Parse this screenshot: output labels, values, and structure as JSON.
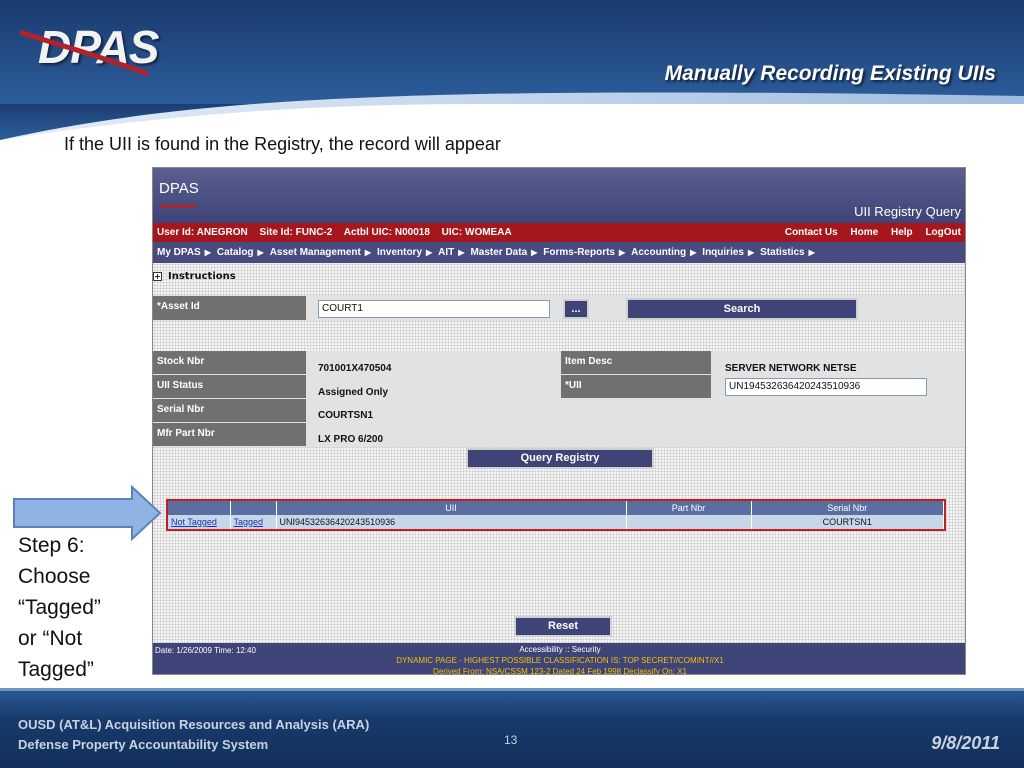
{
  "slide": {
    "logo_text": "DPAS",
    "title": "Manually Recording Existing UIIs",
    "intro": "If the UII is found in the Registry, the record will appear",
    "step": [
      "Step 6:",
      "Choose",
      "“Tagged”",
      "or “Not",
      "Tagged”"
    ],
    "footer_line1": "OUSD (AT&L) Acquisition Resources and Analysis (ARA)",
    "footer_line2": "Defense Property Accountability System",
    "page_number": "13",
    "date": "9/8/2011"
  },
  "app": {
    "logo": "DPAS",
    "page_title": "UII Registry Query",
    "user_info": [
      "User Id: ANEGRON",
      "Site Id: FUNC-2",
      "Actbl UIC: N00018",
      "UIC: WOMEAA"
    ],
    "top_links": [
      "Contact Us",
      "Home",
      "Help",
      "LogOut"
    ],
    "menu": [
      "My DPAS",
      "Catalog",
      "Asset Management",
      "Inventory",
      "AIT",
      "Master Data",
      "Forms-Reports",
      "Accounting",
      "Inquiries",
      "Statistics"
    ],
    "instructions_label": "Instructions",
    "asset_id_label": "*Asset Id",
    "asset_id_value": "COURT1",
    "lookup_button": "...",
    "search_button": "Search",
    "fields": {
      "stock_nbr_label": "Stock Nbr",
      "stock_nbr_value": "701001X470504",
      "uii_status_label": "UII Status",
      "uii_status_value": "Assigned Only",
      "serial_nbr_label": "Serial Nbr",
      "serial_nbr_value": "COURTSN1",
      "mfr_part_nbr_label": "Mfr Part Nbr",
      "mfr_part_nbr_value": "LX PRO 6/200",
      "item_desc_label": "Item Desc",
      "item_desc_value": "SERVER NETWORK NETSE",
      "uii_label": "*UII",
      "uii_value": "UN194532636420243510936"
    },
    "query_button": "Query Registry",
    "results": {
      "headers": [
        "",
        "",
        "UII",
        "Part Nbr",
        "Serial Nbr"
      ],
      "row": {
        "not_tagged": "Not Tagged",
        "tagged": "Tagged",
        "uii": "UNI94532636420243510936",
        "part_nbr": "",
        "serial_nbr": "COURTSN1"
      }
    },
    "reset_button": "Reset",
    "footer": {
      "date_time": "Date: 1/26/2009 Time: 12:40",
      "accessibility": "Accessibility :: Security",
      "classification": "DYNAMIC PAGE - HIGHEST POSSIBLE CLASSIFICATION IS: TOP SECRET//COMINT//X1",
      "derived": "Derived From: NSA/CSSM 123-2 Dated 24 Feb 1998 Declassify On: X1"
    }
  },
  "colors": {
    "header_blue": "#1c3f73",
    "app_header": "#3f4478",
    "user_bar_red": "#a5161d",
    "result_border": "#c0201f",
    "arrow_fill": "#8fb4e3"
  }
}
